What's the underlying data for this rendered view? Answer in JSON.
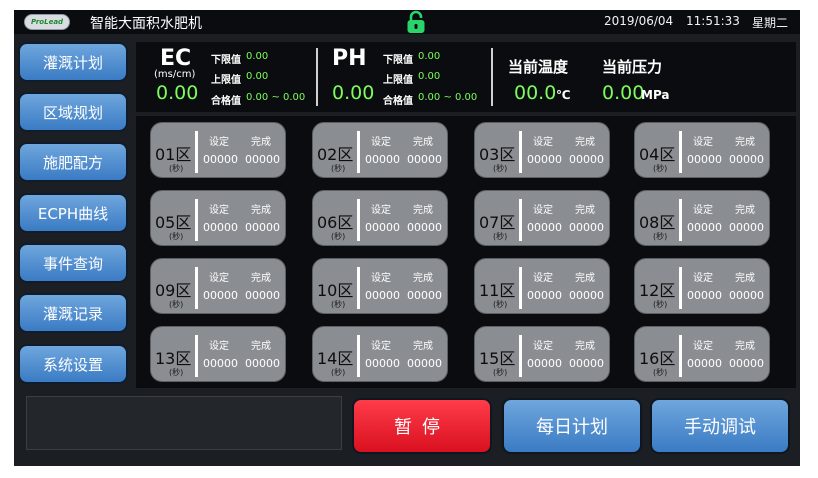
{
  "topbar": {
    "logo_text": "ProLead",
    "title": "智能大面积水肥机",
    "date": "2019/06/04",
    "time": "11:51:33",
    "weekday": "星期二",
    "lock_color": "#2bd36b"
  },
  "sidebar": {
    "items": [
      {
        "label": "灌溉计划"
      },
      {
        "label": "区域规划"
      },
      {
        "label": "施肥配方"
      },
      {
        "label": "ECPH曲线"
      },
      {
        "label": "事件查询"
      },
      {
        "label": "灌溉记录"
      },
      {
        "label": "系统设置"
      }
    ]
  },
  "ec": {
    "title": "EC",
    "unit": "(ms/cm)",
    "value": "0.00",
    "lower_label": "下限值",
    "lower_value": "0.00",
    "upper_label": "上限值",
    "upper_value": "0.00",
    "qualified_label": "合格值",
    "qualified_value": "0.00 ~ 0.00"
  },
  "ph": {
    "title": "PH",
    "value": "0.00",
    "lower_label": "下限值",
    "lower_value": "0.00",
    "upper_label": "上限值",
    "upper_value": "0.00",
    "qualified_label": "合格值",
    "qualified_value": "0.00 ~ 0.00"
  },
  "temperature": {
    "label": "当前温度",
    "value": "00.0",
    "unit": "℃"
  },
  "pressure": {
    "label": "当前压力",
    "value": "0.00",
    "unit": "MPa"
  },
  "zones": [
    {
      "name": "01区",
      "sec": "(秒)",
      "set_label": "设定",
      "done_label": "完成",
      "set": "00000",
      "done": "00000"
    },
    {
      "name": "02区",
      "sec": "(秒)",
      "set_label": "设定",
      "done_label": "完成",
      "set": "00000",
      "done": "00000"
    },
    {
      "name": "03区",
      "sec": "(秒)",
      "set_label": "设定",
      "done_label": "完成",
      "set": "00000",
      "done": "00000"
    },
    {
      "name": "04区",
      "sec": "(秒)",
      "set_label": "设定",
      "done_label": "完成",
      "set": "00000",
      "done": "00000"
    },
    {
      "name": "05区",
      "sec": "(秒)",
      "set_label": "设定",
      "done_label": "完成",
      "set": "00000",
      "done": "00000"
    },
    {
      "name": "06区",
      "sec": "(秒)",
      "set_label": "设定",
      "done_label": "完成",
      "set": "00000",
      "done": "00000"
    },
    {
      "name": "07区",
      "sec": "(秒)",
      "set_label": "设定",
      "done_label": "完成",
      "set": "00000",
      "done": "00000"
    },
    {
      "name": "08区",
      "sec": "(秒)",
      "set_label": "设定",
      "done_label": "完成",
      "set": "00000",
      "done": "00000"
    },
    {
      "name": "09区",
      "sec": "(秒)",
      "set_label": "设定",
      "done_label": "完成",
      "set": "00000",
      "done": "00000"
    },
    {
      "name": "10区",
      "sec": "(秒)",
      "set_label": "设定",
      "done_label": "完成",
      "set": "00000",
      "done": "00000"
    },
    {
      "name": "11区",
      "sec": "(秒)",
      "set_label": "设定",
      "done_label": "完成",
      "set": "00000",
      "done": "00000"
    },
    {
      "name": "12区",
      "sec": "(秒)",
      "set_label": "设定",
      "done_label": "完成",
      "set": "00000",
      "done": "00000"
    },
    {
      "name": "13区",
      "sec": "(秒)",
      "set_label": "设定",
      "done_label": "完成",
      "set": "00000",
      "done": "00000"
    },
    {
      "name": "14区",
      "sec": "(秒)",
      "set_label": "设定",
      "done_label": "完成",
      "set": "00000",
      "done": "00000"
    },
    {
      "name": "15区",
      "sec": "(秒)",
      "set_label": "设定",
      "done_label": "完成",
      "set": "00000",
      "done": "00000"
    },
    {
      "name": "16区",
      "sec": "(秒)",
      "set_label": "设定",
      "done_label": "完成",
      "set": "00000",
      "done": "00000"
    }
  ],
  "bottom": {
    "pause_label": "暂停",
    "daily_plan_label": "每日计划",
    "manual_debug_label": "手动调试"
  }
}
